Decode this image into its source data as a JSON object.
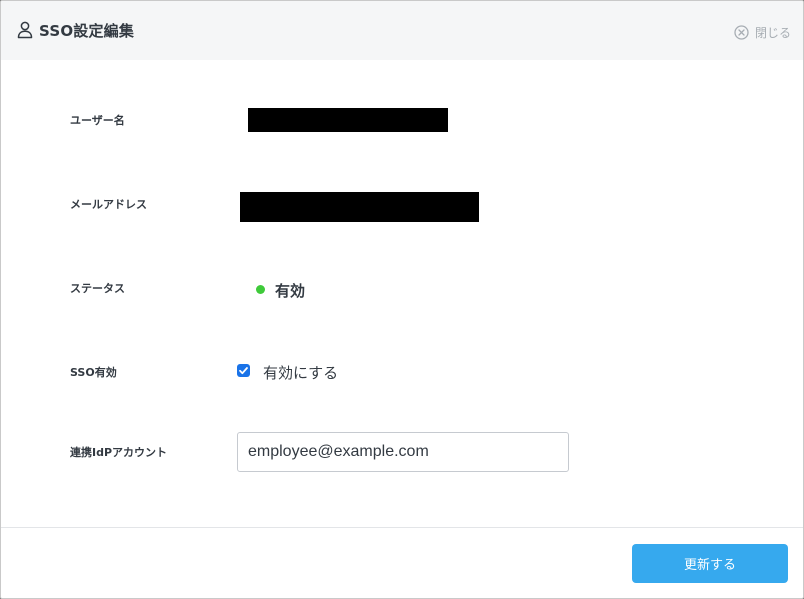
{
  "dialog": {
    "title": "SSO設定編集",
    "close_label": "閉じる"
  },
  "fields": {
    "username_label": "ユーザー名",
    "email_label": "メールアドレス",
    "status_label": "ステータス",
    "status_value": "有効",
    "sso_label": "SSO有効",
    "sso_checkbox_label": "有効にする",
    "sso_checked": true,
    "idp_account_label": "連携IdPアカウント",
    "idp_account_value": "employee@example.com"
  },
  "footer": {
    "update_label": "更新する"
  },
  "colors": {
    "primary_button": "#36a9ee",
    "status_active": "#3fca3a",
    "checkbox": "#1a73e8"
  }
}
